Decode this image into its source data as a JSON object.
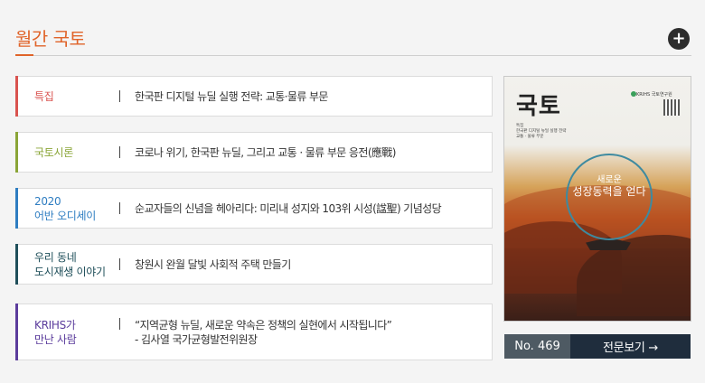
{
  "section": {
    "title": "월간 국토",
    "more_icon": "plus-icon"
  },
  "items": [
    {
      "category_lines": [
        "특집"
      ],
      "color": "#d9534f",
      "text_lines": [
        "한국판 디지털 뉴딜 실행 전략: 교통·물류 부문"
      ]
    },
    {
      "category_lines": [
        "국토시론"
      ],
      "color": "#8aa537",
      "text_lines": [
        "코로나 위기, 한국판 뉴딜, 그리고 교통 · 물류 부문 응전(應戰)"
      ]
    },
    {
      "category_lines": [
        "2020",
        "어반 오디세이"
      ],
      "color": "#2e7dc1",
      "text_lines": [
        "순교자들의 신념을 헤아리다: 미리내 성지와 103위 시성(諡聖) 기념성당"
      ]
    },
    {
      "category_lines": [
        "우리 동네",
        "도시재생 이야기"
      ],
      "color": "#1f4f5a",
      "text_lines": [
        "창원시 완월 달빛 사회적 주택 만들기"
      ]
    },
    {
      "category_lines": [
        "KRIHS가",
        "만난 사람"
      ],
      "color": "#5b3c9c",
      "text_lines": [
        "“지역균형 뉴딜, 새로운 약속은 정책의 실현에서 시작됩니다”",
        "- 김사열 국가균형발전위원장"
      ]
    }
  ],
  "cover": {
    "title": "국토",
    "publisher": "KRIHS 국토연구원",
    "small_lines": [
      "특집",
      "한국판 디지털 뉴딜 실행 전략",
      "교통 · 물류 부문"
    ],
    "circle_line1": "새로운",
    "circle_line2": "성장동력을 얻다"
  },
  "footer": {
    "issue": "No. 469",
    "view_label": "전문보기 →"
  }
}
